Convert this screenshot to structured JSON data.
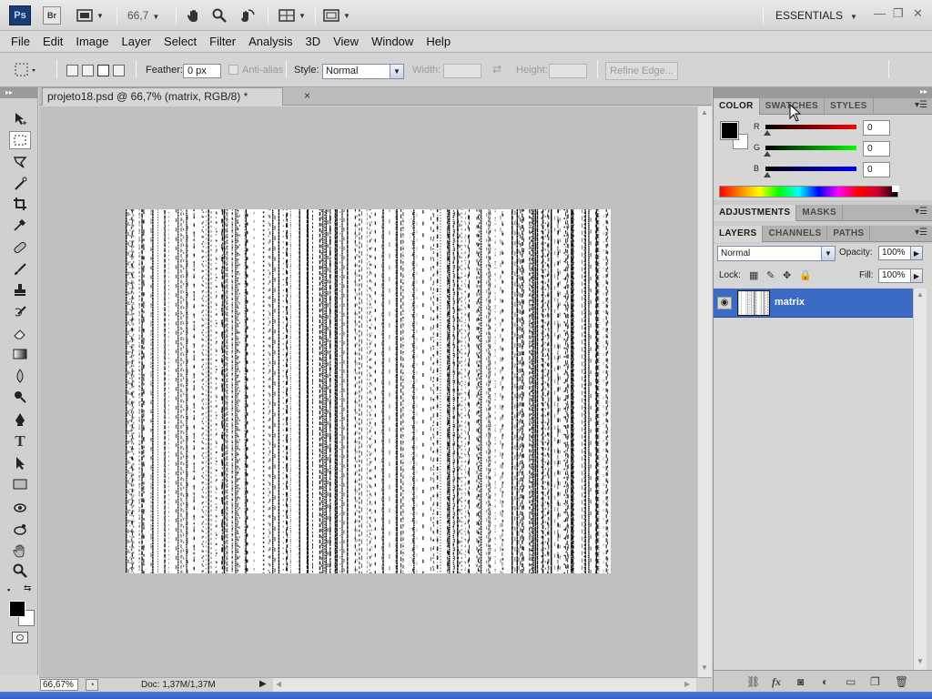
{
  "app": {
    "logo_ps": "Ps",
    "logo_br": "Br",
    "zoom": "66,7",
    "workspace": "ESSENTIALS"
  },
  "menu": [
    "File",
    "Edit",
    "Image",
    "Layer",
    "Select",
    "Filter",
    "Analysis",
    "3D",
    "View",
    "Window",
    "Help"
  ],
  "options": {
    "feather_label": "Feather:",
    "feather_value": "0 px",
    "anti_alias_label": "Anti-alias",
    "style_label": "Style:",
    "style_value": "Normal",
    "width_label": "Width:",
    "height_label": "Height:",
    "refine_edge": "Refine Edge..."
  },
  "document": {
    "tab_title": "projeto18.psd @ 66,7% (matrix, RGB/8) *",
    "close": "×"
  },
  "status": {
    "zoom": "66,67%",
    "doc_info": "Doc: 1,37M/1,37M"
  },
  "panels": {
    "color_tabs": [
      "COLOR",
      "SWATCHES",
      "STYLES"
    ],
    "color": {
      "r_label": "R",
      "r_value": "0",
      "g_label": "G",
      "g_value": "0",
      "b_label": "B",
      "b_value": "0",
      "foreground": "#000000",
      "background": "#ffffff"
    },
    "adjust_tabs": [
      "ADJUSTMENTS",
      "MASKS"
    ],
    "layer_tabs": [
      "LAYERS",
      "CHANNELS",
      "PATHS"
    ],
    "layers": {
      "blend_mode": "Normal",
      "opacity_label": "Opacity:",
      "opacity_value": "100%",
      "lock_label": "Lock:",
      "fill_label": "Fill:",
      "fill_value": "100%",
      "items": [
        {
          "name": "matrix",
          "visible": true,
          "selected": true
        }
      ]
    }
  },
  "colors": {
    "selection_blue": "#3b6bc4",
    "ps_logo": "#1c3b72"
  }
}
